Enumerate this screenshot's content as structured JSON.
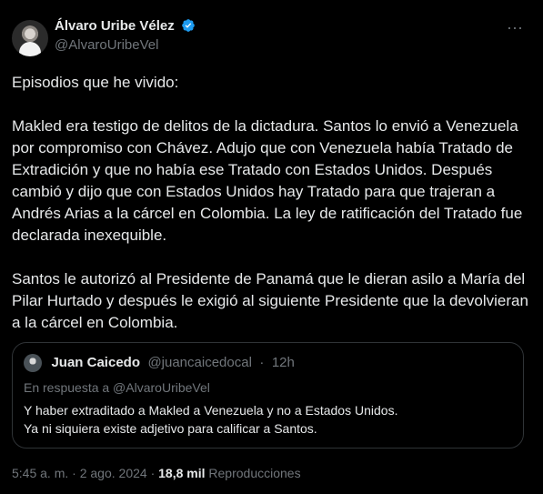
{
  "post": {
    "author": {
      "display_name": "Álvaro Uribe Vélez",
      "handle": "@AlvaroUribeVel",
      "verified_icon": "verified-badge-icon",
      "avatar_icon": "profile-avatar"
    },
    "more_icon": "more-options-icon",
    "more_label": "···",
    "text": "Episodios que he vivido:\n\nMakled era testigo de delitos de la dictadura. Santos lo envió a Venezuela por compromiso con Chávez. Adujo que con Venezuela había Tratado de Extradición  y que no había ese Tratado con Estados Unidos. Después cambió y dijo que con Estados Unidos hay Tratado para que trajeran a Andrés Arias a la cárcel en Colombia. La ley de ratificación del Tratado fue declarada inexequible.\n\nSantos le autorizó al Presidente de Panamá que le dieran asilo a María del Pilar Hurtado y después le exigió al siguiente Presidente  que la devolvieran a la cárcel en Colombia.",
    "quote": {
      "author": {
        "display_name": "Juan Caicedo",
        "handle": "@juancaicedocal",
        "avatar_icon": "quoted-avatar"
      },
      "dot": "·",
      "time": "12h",
      "reply_to": "En respuesta a @AlvaroUribeVel",
      "text": "Y haber extraditado a Makled a Venezuela y no a Estados Unidos.\nYa ni siquiera existe adjetivo para calificar a Santos."
    },
    "meta": {
      "time": "5:45 a. m.",
      "separator_1": "·",
      "date": "2 ago. 2024",
      "separator_2": "·",
      "views_count": "18,8 mil",
      "views_label": "Reproducciones"
    },
    "colors": {
      "background": "#000000",
      "primary_text": "#e7e9ea",
      "secondary_text": "#71767b",
      "border": "#2f3336",
      "verified": "#1d9bf0"
    }
  }
}
